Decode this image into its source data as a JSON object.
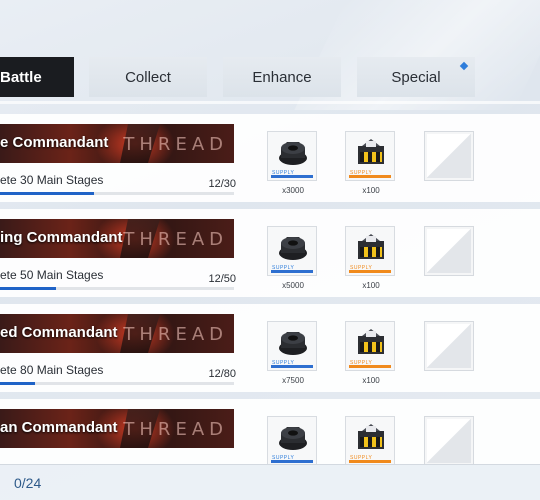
{
  "tabs": [
    {
      "label": "Battle",
      "active": true
    },
    {
      "label": "Collect",
      "active": false
    },
    {
      "label": "Enhance",
      "active": false
    },
    {
      "label": "Special",
      "active": false,
      "has_notification": true
    }
  ],
  "missions": [
    {
      "title": "e Commandant",
      "banner_text": "THREAD",
      "description": "ete 30 Main Stages",
      "progress": "12/30",
      "fraction": 0.4,
      "rewards": [
        {
          "type": "gear-nut",
          "qty": "x3000",
          "tier": "blue"
        },
        {
          "type": "supply-crate",
          "qty": "x100",
          "tier": "orange"
        }
      ]
    },
    {
      "title": "ing Commandant",
      "banner_text": "THREAD",
      "description": "ete 50 Main Stages",
      "progress": "12/50",
      "fraction": 0.24,
      "rewards": [
        {
          "type": "gear-nut",
          "qty": "x5000",
          "tier": "blue"
        },
        {
          "type": "supply-crate",
          "qty": "x100",
          "tier": "orange"
        }
      ]
    },
    {
      "title": "ed Commandant",
      "banner_text": "THREAD",
      "description": "ete 80 Main Stages",
      "progress": "12/80",
      "fraction": 0.15,
      "rewards": [
        {
          "type": "gear-nut",
          "qty": "x7500",
          "tier": "blue"
        },
        {
          "type": "supply-crate",
          "qty": "x100",
          "tier": "orange"
        }
      ]
    },
    {
      "title": "an Commandant",
      "banner_text": "THREAD",
      "description": "",
      "progress": "",
      "fraction": 0.1,
      "rewards": [
        {
          "type": "gear-nut",
          "qty": "",
          "tier": "blue"
        },
        {
          "type": "supply-crate",
          "qty": "",
          "tier": "orange"
        }
      ]
    }
  ],
  "reward_label": "SUPPLY",
  "footer": {
    "completed": "0/24"
  },
  "colors": {
    "accent": "#1f63c7",
    "active_tab": "#1a1c20",
    "orange_tier": "#f08a1c",
    "blue_tier": "#2e6fd0"
  }
}
